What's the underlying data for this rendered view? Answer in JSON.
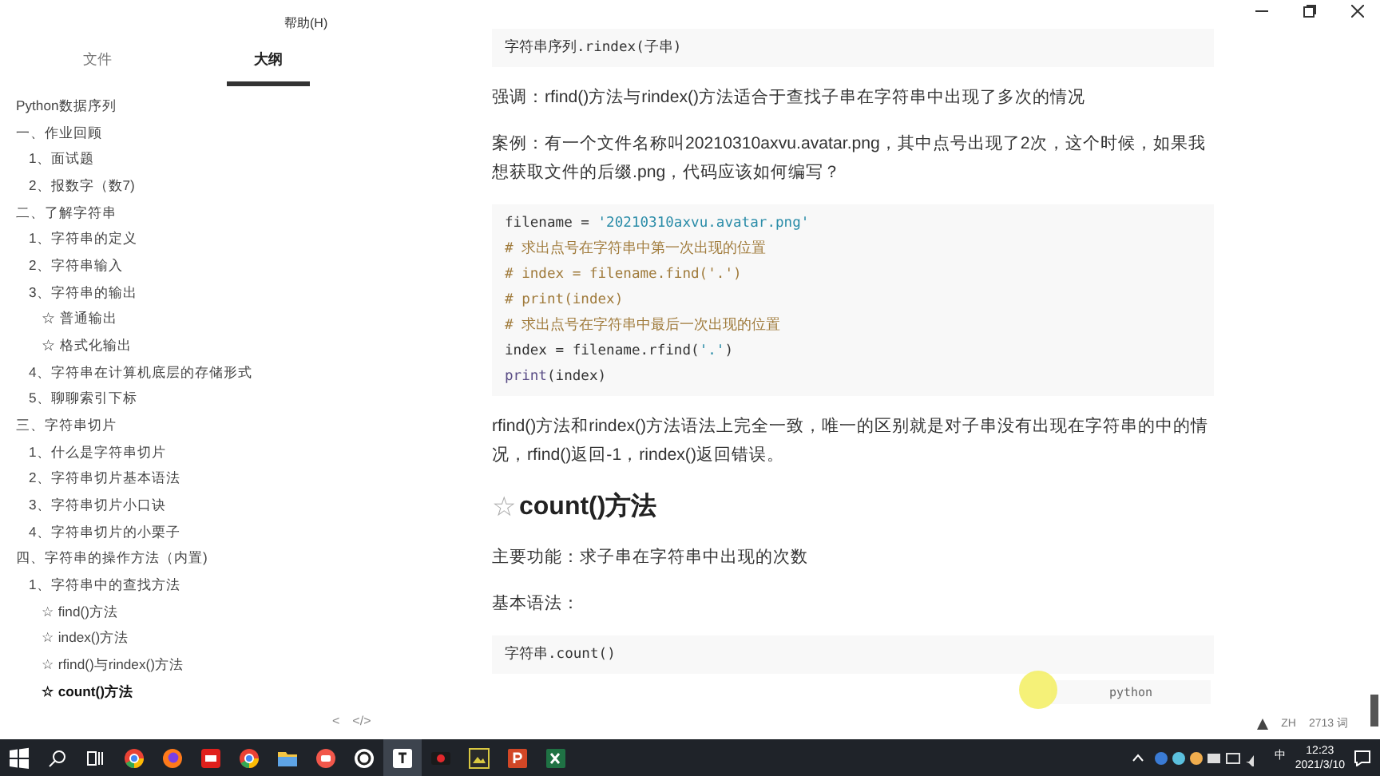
{
  "menu": {
    "help": "帮助(H)"
  },
  "sidebar": {
    "tabs": [
      {
        "label": "文件",
        "selected": false
      },
      {
        "label": "大纲",
        "selected": true
      }
    ],
    "outline": [
      {
        "label": "Python数据序列",
        "selected": false
      },
      {
        "label": "一、作业回顾",
        "selected": false,
        "children": [
          {
            "label": "1、面试题",
            "selected": false
          },
          {
            "label": "2、报数字（数7)",
            "selected": false
          }
        ]
      },
      {
        "label": "二、了解字符串",
        "selected": false,
        "children": [
          {
            "label": "1、字符串的定义",
            "selected": false
          },
          {
            "label": "2、字符串输入",
            "selected": false
          },
          {
            "label": "3、字符串的输出",
            "selected": false,
            "children": [
              {
                "label": "☆ 普通输出",
                "selected": false
              },
              {
                "label": "☆ 格式化输出",
                "selected": false
              }
            ]
          },
          {
            "label": "4、字符串在计算机底层的存储形式",
            "selected": false
          },
          {
            "label": "5、聊聊索引下标",
            "selected": false
          }
        ]
      },
      {
        "label": "三、字符串切片",
        "selected": false,
        "children": [
          {
            "label": "1、什么是字符串切片",
            "selected": false
          },
          {
            "label": "2、字符串切片基本语法",
            "selected": false
          },
          {
            "label": "3、字符串切片小口诀",
            "selected": false
          },
          {
            "label": "4、字符串切片的小栗子",
            "selected": false
          }
        ]
      },
      {
        "label": "四、字符串的操作方法（内置)",
        "selected": false,
        "children": [
          {
            "label": "1、字符串中的查找方法",
            "selected": false,
            "children": [
              {
                "label": "☆ find()方法",
                "selected": false
              },
              {
                "label": "☆ index()方法",
                "selected": false
              },
              {
                "label": "☆ rfind()与rindex()方法",
                "selected": false
              },
              {
                "label": "☆ count()方法",
                "selected": true
              }
            ]
          }
        ]
      }
    ],
    "footer_buttons": [
      "<",
      "</>"
    ]
  },
  "content": [
    {
      "kind": "code",
      "lines": [
        [
          {
            "text": "字符串序列.",
            "kind": "plain"
          },
          {
            "text": "rindex",
            "kind": "plain"
          },
          {
            "text": "(子串)",
            "kind": "plain"
          }
        ]
      ]
    },
    {
      "kind": "paragraph",
      "text": "强调：rfind()方法与rindex()方法适合于查找子串在字符串中出现了多次的情况"
    },
    {
      "kind": "paragraph",
      "text": "案例：有一个文件名称叫20210310axvu.avatar.png，其中点号出现了2次，这个时候，如果我想获取文件的后缀.png，代码应该如何编写？"
    },
    {
      "kind": "code",
      "lines": [
        [
          {
            "text": "filename = ",
            "kind": "plain"
          },
          {
            "text": "'20210310axvu.avatar.png'",
            "kind": "string"
          }
        ],
        [
          {
            "text": "# 求出点号在字符串中第一次出现的位置",
            "kind": "comment"
          }
        ],
        [
          {
            "text": "# index = filename.find('.')",
            "kind": "comment"
          }
        ],
        [
          {
            "text": "# print(index)",
            "kind": "comment"
          }
        ],
        [
          {
            "text": "# 求出点号在字符串中最后一次出现的位置",
            "kind": "comment"
          }
        ],
        [
          {
            "text": "index = filename.rfind(",
            "kind": "plain"
          },
          {
            "text": "'.'",
            "kind": "string"
          },
          {
            "text": ")",
            "kind": "plain"
          }
        ],
        [
          {
            "text": "print",
            "kind": "builtin"
          },
          {
            "text": "(index)",
            "kind": "plain"
          }
        ]
      ]
    },
    {
      "kind": "paragraph",
      "text": "rfind()方法和rindex()方法语法上完全一致，唯一的区别就是对子串没有出现在字符串的中的情况，rfind()返回-1，rindex()返回错误。"
    },
    {
      "kind": "heading",
      "icon": "☆",
      "text": "count()方法"
    },
    {
      "kind": "paragraph",
      "text": "主要功能：求子串在字符串中出现的次数"
    },
    {
      "kind": "paragraph",
      "text": "基本语法："
    },
    {
      "kind": "code",
      "lines": [
        [
          {
            "text": "字符串.count()",
            "kind": "plain"
          }
        ]
      ],
      "language": "python"
    }
  ],
  "status": {
    "language": "ZH",
    "word_count": "2713 词"
  },
  "taskbar": {
    "tray_ime": "中",
    "time": "12:23",
    "date": "2021/3/10",
    "apps": [
      {
        "kind": "chrome",
        "selected": false
      },
      {
        "kind": "firefox",
        "selected": false
      },
      {
        "kind": "red",
        "selected": false
      },
      {
        "kind": "chrome",
        "selected": false
      },
      {
        "kind": "folder",
        "selected": false
      },
      {
        "kind": "recorder",
        "selected": false
      },
      {
        "kind": "ring",
        "selected": false
      },
      {
        "kind": "typora",
        "selected": true
      },
      {
        "kind": "video",
        "selected": false
      },
      {
        "kind": "image",
        "selected": false
      },
      {
        "kind": "ppt",
        "selected": false
      },
      {
        "kind": "excel",
        "selected": false
      }
    ]
  }
}
